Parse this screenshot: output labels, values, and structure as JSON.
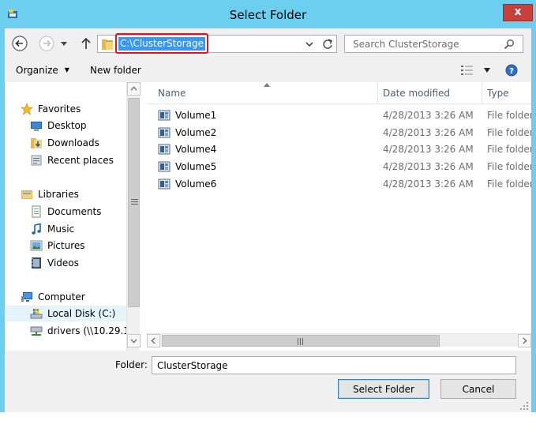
{
  "window": {
    "title": "Select Folder",
    "close_label": "x"
  },
  "address_bar": {
    "path": "C:\\ClusterStorage",
    "search_placeholder": "Search ClusterStorage"
  },
  "toolbar": {
    "organize_label": "Organize",
    "new_folder_label": "New folder"
  },
  "nav_pane": {
    "favorites": {
      "label": "Favorites",
      "items": [
        {
          "label": "Desktop",
          "icon": "desktop-icon"
        },
        {
          "label": "Downloads",
          "icon": "downloads-icon"
        },
        {
          "label": "Recent places",
          "icon": "recent-places-icon"
        }
      ]
    },
    "libraries": {
      "label": "Libraries",
      "items": [
        {
          "label": "Documents",
          "icon": "documents-icon"
        },
        {
          "label": "Music",
          "icon": "music-icon"
        },
        {
          "label": "Pictures",
          "icon": "pictures-icon"
        },
        {
          "label": "Videos",
          "icon": "videos-icon"
        }
      ]
    },
    "computer": {
      "label": "Computer",
      "items": [
        {
          "label": "Local Disk (C:)",
          "icon": "local-disk-icon",
          "selected": true
        },
        {
          "label": "drivers (\\\\10.29.1",
          "icon": "network-drive-icon"
        }
      ]
    }
  },
  "file_list": {
    "columns": [
      "Name",
      "Date modified",
      "Type"
    ],
    "rows": [
      {
        "name": "Volume1",
        "date": "4/28/2013 3:26 AM",
        "type": "File folder"
      },
      {
        "name": "Volume2",
        "date": "4/28/2013 3:26 AM",
        "type": "File folder"
      },
      {
        "name": "Volume4",
        "date": "4/28/2013 3:26 AM",
        "type": "File folder"
      },
      {
        "name": "Volume5",
        "date": "4/28/2013 3:26 AM",
        "type": "File folder"
      },
      {
        "name": "Volume6",
        "date": "4/28/2013 3:26 AM",
        "type": "File folder"
      }
    ]
  },
  "bottom": {
    "folder_label": "Folder:",
    "folder_value": "ClusterStorage",
    "select_label": "Select Folder",
    "cancel_label": "Cancel"
  },
  "colors": {
    "title_bar": "#6dcff0",
    "close_button": "#c7413a",
    "selection": "#3399ff",
    "highlight_outline": "#e0161e"
  }
}
